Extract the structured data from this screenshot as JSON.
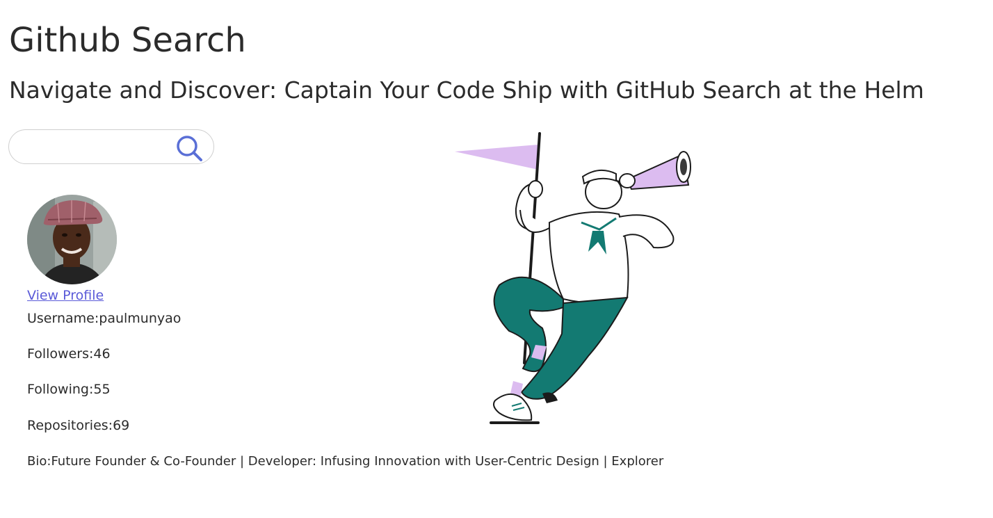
{
  "header": {
    "title": "Github Search",
    "subtitle": "Navigate and Discover: Captain Your Code Ship with GitHub Search at the Helm"
  },
  "search": {
    "placeholder": "",
    "value": "",
    "icon": "search-icon"
  },
  "profile": {
    "link_label": "View Profile",
    "username_label": "Username:",
    "username": "paulmunyao",
    "followers_label": "Followers:",
    "followers": "46",
    "following_label": "Following:",
    "following": "55",
    "repositories_label": "Repositories:",
    "repositories": "69",
    "bio_label": "Bio:",
    "bio": "Future Founder & Co-Founder | Developer: Infusing Innovation with User-Centric Design | Explorer"
  },
  "colors": {
    "accent": "#5a5ad8",
    "search_icon": "#5a6fd6",
    "flag": "#dcbcf0",
    "pants": "#137a72",
    "text": "#2b2b2b"
  }
}
